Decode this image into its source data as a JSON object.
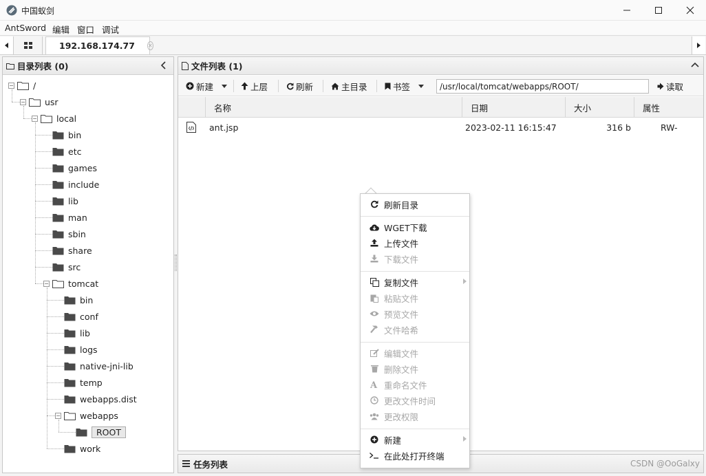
{
  "window": {
    "title": "中国蚁剑",
    "controls": [
      "minimize",
      "maximize",
      "close"
    ]
  },
  "menu": [
    "AntSword",
    "编辑",
    "窗口",
    "调试"
  ],
  "tabs": {
    "active_tab_label": "192.168.174.77"
  },
  "left_panel": {
    "title": "目录列表 (0)"
  },
  "tree": [
    {
      "label": "/",
      "depth": 0,
      "type": "folder-open"
    },
    {
      "label": "usr",
      "depth": 1,
      "type": "folder-open"
    },
    {
      "label": "local",
      "depth": 2,
      "type": "folder-open"
    },
    {
      "label": "bin",
      "depth": 3,
      "type": "folder"
    },
    {
      "label": "etc",
      "depth": 3,
      "type": "folder"
    },
    {
      "label": "games",
      "depth": 3,
      "type": "folder"
    },
    {
      "label": "include",
      "depth": 3,
      "type": "folder"
    },
    {
      "label": "lib",
      "depth": 3,
      "type": "folder"
    },
    {
      "label": "man",
      "depth": 3,
      "type": "folder"
    },
    {
      "label": "sbin",
      "depth": 3,
      "type": "folder"
    },
    {
      "label": "share",
      "depth": 3,
      "type": "folder"
    },
    {
      "label": "src",
      "depth": 3,
      "type": "folder"
    },
    {
      "label": "tomcat",
      "depth": 3,
      "type": "folder-open"
    },
    {
      "label": "bin",
      "depth": 4,
      "type": "folder"
    },
    {
      "label": "conf",
      "depth": 4,
      "type": "folder"
    },
    {
      "label": "lib",
      "depth": 4,
      "type": "folder"
    },
    {
      "label": "logs",
      "depth": 4,
      "type": "folder"
    },
    {
      "label": "native-jni-lib",
      "depth": 4,
      "type": "folder"
    },
    {
      "label": "temp",
      "depth": 4,
      "type": "folder"
    },
    {
      "label": "webapps.dist",
      "depth": 4,
      "type": "folder"
    },
    {
      "label": "webapps",
      "depth": 4,
      "type": "folder-open"
    },
    {
      "label": "ROOT",
      "depth": 5,
      "type": "folder",
      "selected": true
    },
    {
      "label": "work",
      "depth": 4,
      "type": "folder"
    }
  ],
  "right_panel": {
    "title": "文件列表 (1)"
  },
  "toolbar": {
    "new_label": "新建",
    "up_label": "上层",
    "refresh_label": "刷新",
    "home_label": "主目录",
    "bookmark_label": "书签",
    "path_value": "/usr/local/tomcat/webapps/ROOT/",
    "read_label": "读取"
  },
  "grid": {
    "columns": [
      "名称",
      "日期",
      "大小",
      "属性"
    ],
    "rows": [
      {
        "name": "ant.jsp",
        "date": "2023-02-11 16:15:47",
        "size": "316 b",
        "attr": "RW-"
      }
    ]
  },
  "task_panel": {
    "title": "任务列表"
  },
  "context_menu": {
    "groups": [
      [
        {
          "label": "刷新目录",
          "icon": "refresh-icon",
          "disabled": false
        }
      ],
      [
        {
          "label": "WGET下载",
          "icon": "cloud-download-icon",
          "disabled": false
        },
        {
          "label": "上传文件",
          "icon": "upload-icon",
          "disabled": false
        },
        {
          "label": "下载文件",
          "icon": "download-icon",
          "disabled": true
        }
      ],
      [
        {
          "label": "复制文件",
          "icon": "copy-icon",
          "disabled": false,
          "submenu": true
        },
        {
          "label": "粘贴文件",
          "icon": "paste-icon",
          "disabled": true
        },
        {
          "label": "预览文件",
          "icon": "eye-icon",
          "disabled": true
        },
        {
          "label": "文件哈希",
          "icon": "hammer-icon",
          "disabled": true
        }
      ],
      [
        {
          "label": "编辑文件",
          "icon": "edit-icon",
          "disabled": true
        },
        {
          "label": "删除文件",
          "icon": "trash-icon",
          "disabled": true
        },
        {
          "label": "重命名文件",
          "icon": "font-icon",
          "disabled": true
        },
        {
          "label": "更改文件时间",
          "icon": "clock-icon",
          "disabled": true
        },
        {
          "label": "更改权限",
          "icon": "users-icon",
          "disabled": true
        }
      ],
      [
        {
          "label": "新建",
          "icon": "plus-circle-icon",
          "disabled": false,
          "submenu": true
        },
        {
          "label": "在此处打开终端",
          "icon": "terminal-icon",
          "disabled": false
        }
      ]
    ]
  },
  "watermark": "CSDN @OoGalxy",
  "colors": {
    "folder": "#4a4a4a",
    "disabled_text": "#a7a7a7",
    "border": "#c6c6c6"
  }
}
